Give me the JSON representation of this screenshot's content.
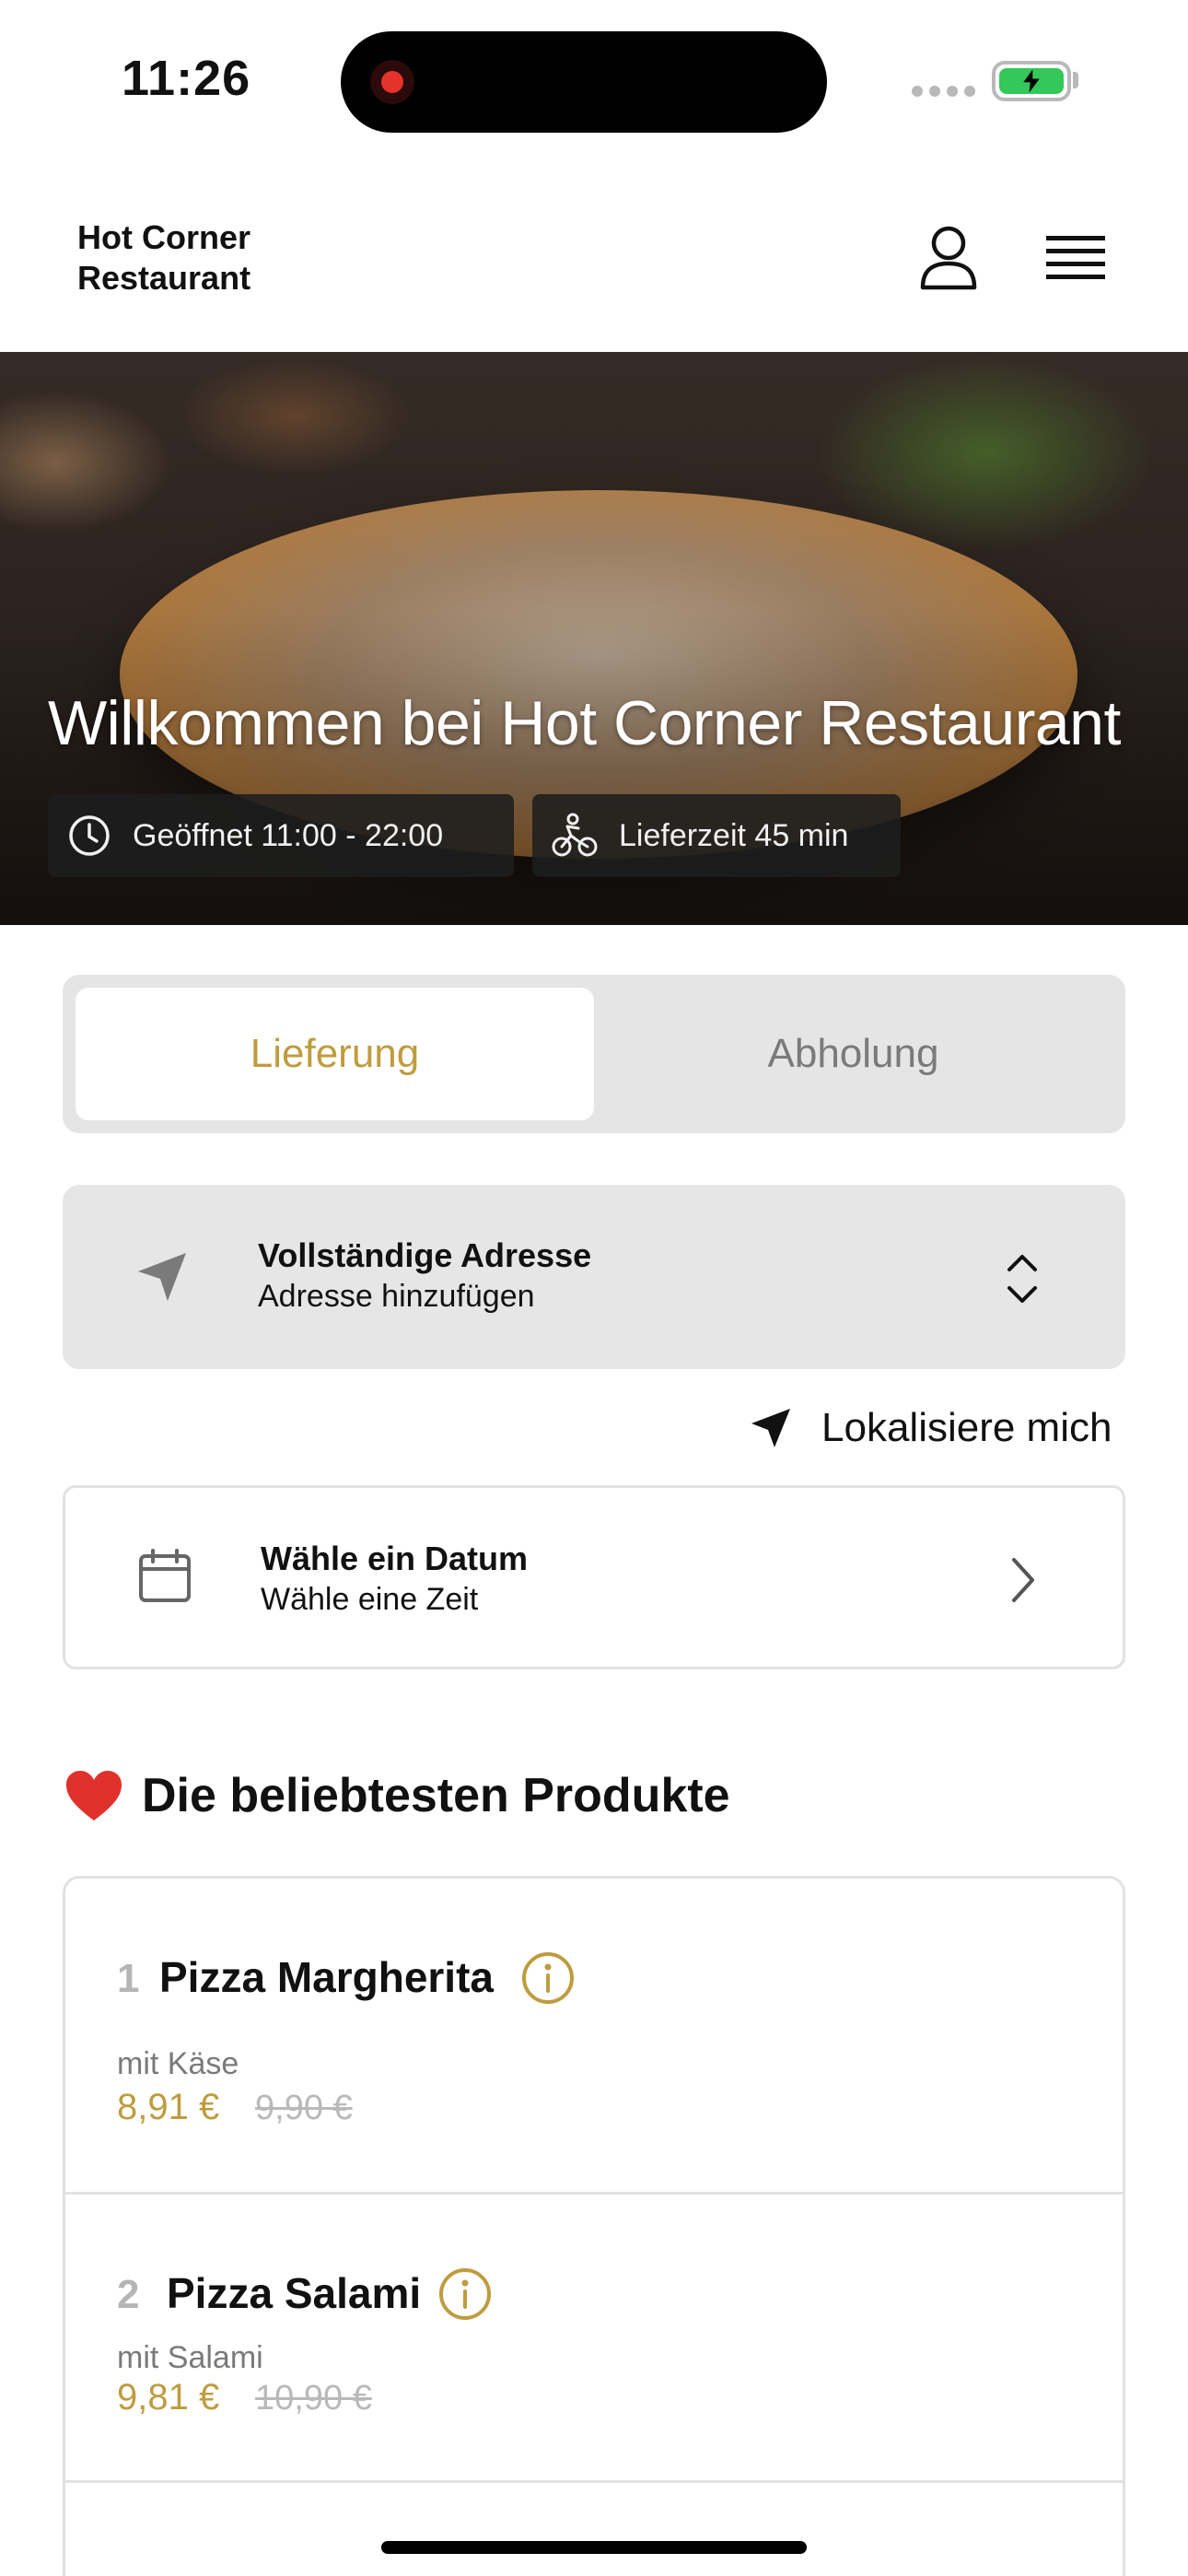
{
  "status_bar": {
    "time": "11:26"
  },
  "header": {
    "brand": "Hot Corner\nRestaurant",
    "profile_icon": "person-icon",
    "menu_icon": "hamburger-menu-icon"
  },
  "hero": {
    "title": "Willkommen bei Hot Corner Restaurant",
    "opening_hours": "Geöffnet 11:00 - 22:00",
    "delivery_time": "Lieferzeit 45 min"
  },
  "mode_tabs": [
    {
      "label": "Lieferung",
      "active": true
    },
    {
      "label": "Abholung",
      "active": false
    }
  ],
  "address": {
    "title": "Vollständige Adresse",
    "subtitle": "Adresse hinzufügen"
  },
  "locate": {
    "label": "Lokalisiere mich"
  },
  "date": {
    "title": "Wähle ein Datum",
    "subtitle": "Wähle eine Zeit"
  },
  "popular": {
    "title": "Die beliebtesten Produkte",
    "products": [
      {
        "rank": "1",
        "name": "Pizza Margherita",
        "description": "mit Käse",
        "price": "8,91 €",
        "old_price": "9,90 €"
      },
      {
        "rank": "2",
        "name": "Pizza Salami",
        "description": "mit Salami",
        "price": "9,81 €",
        "old_price": "10,90 €"
      }
    ]
  },
  "colors": {
    "accent_gold": "#bf9c3f",
    "battery_green": "#34c759",
    "heart_red": "#e0312b"
  }
}
